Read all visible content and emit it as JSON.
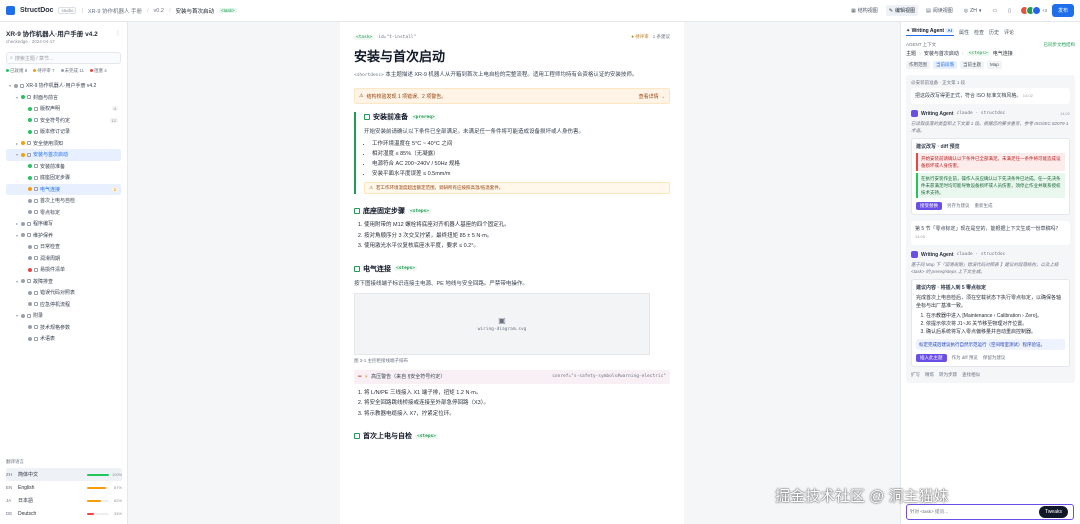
{
  "topbar": {
    "brand": "StructDoc",
    "brand_tag": "studio",
    "crumbs": [
      "XR-9 协作机器人 手册",
      "v0.2",
      "安装与首次启动"
    ],
    "crumb_tag": "<task>",
    "tools": [
      "结构视图",
      "编辑视图",
      "阅读视图"
    ],
    "lang": "ZH",
    "publish": "发布",
    "extra_count": "+3"
  },
  "left": {
    "doc_title": "XR-9 协作机器人·用户手册 v4.2",
    "doc_sub": "checkedge · 2024-04-17",
    "search_placeholder": "搜索主题 / 章节…",
    "stats": [
      {
        "label": "已就绪 8",
        "color": "#22c55e"
      },
      {
        "label": "待评审 7",
        "color": "#f59e0b"
      },
      {
        "label": "未完成 11",
        "color": "#9aa0a8"
      },
      {
        "label": "阻塞 4",
        "color": "#ef4444"
      }
    ],
    "tree": [
      {
        "label": "XR-9 协作机器人·用户手册 v4.2",
        "indent": 0,
        "chev": "▾",
        "color": "#9aa0a8"
      },
      {
        "label": "封面与前言",
        "indent": 1,
        "chev": "▾",
        "color": "#22c55e"
      },
      {
        "label": "版权声明",
        "indent": 2,
        "chev": "",
        "color": "#22c55e",
        "count": "4"
      },
      {
        "label": "安全符号约定",
        "indent": 2,
        "chev": "",
        "color": "#22c55e",
        "count": "12"
      },
      {
        "label": "版本修订记录",
        "indent": 2,
        "chev": "",
        "color": "#22c55e"
      },
      {
        "label": "安全使用须知",
        "indent": 1,
        "chev": "▸",
        "color": "#f59e0b"
      },
      {
        "label": "安装与首次启动",
        "indent": 1,
        "chev": "▾",
        "color": "#f59e0b",
        "sel": true
      },
      {
        "label": "安装前准备",
        "indent": 2,
        "chev": "",
        "color": "#22c55e"
      },
      {
        "label": "底座固定步骤",
        "indent": 2,
        "chev": "",
        "color": "#22c55e"
      },
      {
        "label": "电气连接",
        "indent": 2,
        "chev": "",
        "color": "#f59e0b",
        "count": "2",
        "warn": true,
        "sel2": true
      },
      {
        "label": "首次上电与自检",
        "indent": 2,
        "chev": "",
        "color": "#9aa0a8"
      },
      {
        "label": "零点标定",
        "indent": 2,
        "chev": "",
        "color": "#9aa0a8"
      },
      {
        "label": "程序编写",
        "indent": 1,
        "chev": "▸",
        "color": "#9aa0a8"
      },
      {
        "label": "维护保养",
        "indent": 1,
        "chev": "▾",
        "color": "#9aa0a8"
      },
      {
        "label": "日常检查",
        "indent": 2,
        "chev": "",
        "color": "#9aa0a8"
      },
      {
        "label": "润滑周期",
        "indent": 2,
        "chev": "",
        "color": "#9aa0a8"
      },
      {
        "label": "易损件清单",
        "indent": 2,
        "chev": "",
        "color": "#ef4444"
      },
      {
        "label": "故障排查",
        "indent": 1,
        "chev": "▾",
        "color": "#9aa0a8"
      },
      {
        "label": "错误代码对照表",
        "indent": 2,
        "chev": "",
        "color": "#9aa0a8"
      },
      {
        "label": "应急停机流程",
        "indent": 2,
        "chev": "",
        "color": "#9aa0a8"
      },
      {
        "label": "附录",
        "indent": 1,
        "chev": "▾",
        "color": "#9aa0a8"
      },
      {
        "label": "技术规格参数",
        "indent": 2,
        "chev": "",
        "color": "#9aa0a8"
      },
      {
        "label": "术语表",
        "indent": 2,
        "chev": "",
        "color": "#9aa0a8"
      }
    ],
    "lang_header": "翻译语言",
    "langs": [
      {
        "code": "ZH",
        "name": "简体中文",
        "pct": "100%",
        "v": 1.0,
        "color": "#22c55e",
        "sel": true
      },
      {
        "code": "EN",
        "name": "English",
        "pct": "87%",
        "v": 0.87,
        "color": "#f59e0b"
      },
      {
        "code": "JA",
        "name": "日本語",
        "pct": "62%",
        "v": 0.62,
        "color": "#f59e0b"
      },
      {
        "code": "DE",
        "name": "Deutsch",
        "pct": "34%",
        "v": 0.34,
        "color": "#ef4444"
      }
    ]
  },
  "doc": {
    "head_tag": "<task>",
    "head_id": "id=\"t-install\"",
    "status": "待评审",
    "words": "1 条建议",
    "title": "安装与首次启动",
    "shortdesc_tag": "<shortdesc>",
    "shortdesc": "本主题描述 XR-9 机器人从开箱到首次上电自检的完整流程。适用工程师均持有合资格认证的安装技师。",
    "warning": "结构校验发现 1 项错误、2 项警告。",
    "warning_link": "查看详情 →",
    "s1": {
      "title": "安装前准备",
      "tag": "<prereq>",
      "intro": "开始安装前请确认以下条件已全部满足。未满足任一条件将可能造成设备损坏或人身伤害。",
      "items": [
        "工作环境温度在 5°C ~ 40°C 之间",
        "相对湿度 ≤ 85%（无凝露）",
        "电源符合 AC 200~240V / 50Hz 规格",
        "安装平面水平度误差 ≤ 0.5mm/m"
      ],
      "caution": "若工作环境温度超出额定范围，调研所有应按照高温/低温套件。"
    },
    "s2": {
      "title": "底座固定步骤",
      "tag": "<steps>",
      "items": [
        "使用附带的 M12 螺栓将底座对齐机器人基座的四个固定孔。",
        "按对角顺序分 3 次交叉拧紧，最终扭矩 85 ± 5 N·m。",
        "使用激光水平仪复核底座水平度，要求 ≤ 0.2°。"
      ]
    },
    "s3": {
      "title": "电气连接",
      "tag": "<steps>",
      "intro": "按下图接线端子标识连接主电源、PE 地线与安全回路。严禁带电操作。",
      "fig": "wiring-diagram.svg",
      "figcap": "图 3-1 主控柜接线端子排布",
      "hazard": "高压警告（来自 §安全符号约定）",
      "hazard_ref": "conref=\"s-safety-symbols#warning-electric\"",
      "items": [
        "将 L/N/PE 三线接入 X1 端子排，扭矩 1.2 N·m。",
        "将安全回路跳线桥接或连接至外部急停回路（X3）。",
        "将示教器电缆接入 X7，拧紧定位环。"
      ]
    },
    "s4": {
      "title": "首次上电与自检",
      "tag": "<steps>"
    }
  },
  "right": {
    "tabs": [
      "Writing Agent",
      "属性",
      "检查",
      "历史",
      "评论"
    ],
    "agent_badge": "AI",
    "ctx_label": "AGENT 上下文",
    "ctx_status": "已同步文档结构",
    "ctx_path": [
      "主题",
      "安装与首次启动",
      "<steps>",
      "电气连接"
    ],
    "chips": [
      "作用范围",
      "当前段落",
      "当前主题",
      "Map"
    ],
    "user_meta": "@安装前准备 · 正文第 1 段",
    "user_msg": "把这段改写得更正式，符合 ISO 标准文档风格。",
    "user_time": "14:02",
    "agent_name": "Writing Agent",
    "agent_meta": "claude · structdoc",
    "agent_time": "14:02",
    "agent_note": "已读取段落的类型和上下文第 1 段。根据您的要求重写，参考 ISO/IEC 82079-1 术语。",
    "diff_title": "建议改写 · diff 预览",
    "diff_del": "开始安装前请确认以下条件已全部满足。未满足任一条件将可能造成设备损坏或人身伤害。",
    "diff_add": "在执行安装作业前，操作人员应确认以下先决条件已达成。任一先决条件未获满足时均可能导致设备损坏或人员伤害，须停止作业并联系授权技术支持。",
    "acts": [
      "接受替换",
      "另存为建议",
      "重新生成"
    ],
    "user2": "第 5 节「零点标定」现在是空的，能根据上下文生成一份草稿吗？",
    "user2_time": "14:05",
    "agent2_note": "基于同 Map 下「润滑周期」错误代码对照表 】建议的段落结构，以及上级 <task> 的 prereq/steps 上下文生成。",
    "draft_title": "建议内容 · 将插入到 5 零点标定",
    "draft_intro": "完成首次上电自检后，须在空载状态下执行零点标定，以确保各轴坐标与出厂基准一致。",
    "draft_items": [
      "在示教器中进入 [Maintenance › Calibration › Zero]。",
      "依提示依次将 J1~J6 关节移至物理对齐位置。",
      "确认后系统将写入零点偏移量并自动重启控制器。"
    ],
    "draft_note": "标定完成后建议执行自然示范运行（空间暗室测试）程序验证。",
    "acts2": [
      "插入此主题",
      "作为 diff 预览",
      "保留为建议"
    ],
    "bottom_acts": [
      "扩写",
      "精炼",
      "转为步骤",
      "查找相似"
    ],
    "input_text": "针对 <task> 提问…",
    "input_hint": "Tweaks"
  },
  "watermark": "掘金技术社区 @ 洞主猫妹",
  "colors": {
    "accent": "#1f6feb",
    "ok": "#22c55e",
    "warn": "#f59e0b",
    "err": "#ef4444",
    "agent": "#6b4ee6"
  }
}
